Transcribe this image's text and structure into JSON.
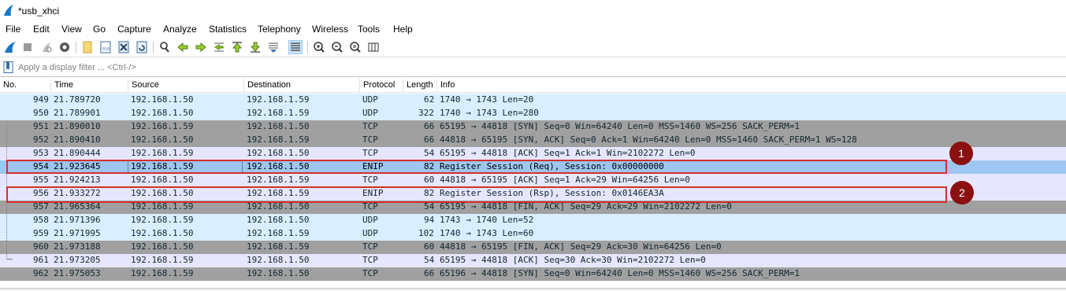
{
  "window": {
    "title": "*usb_xhci"
  },
  "menu": [
    "File",
    "Edit",
    "View",
    "Go",
    "Capture",
    "Analyze",
    "Statistics",
    "Telephony",
    "Wireless",
    "Tools",
    "Help"
  ],
  "filter": {
    "placeholder": "Apply a display filter ... <Ctrl-/>"
  },
  "columns": [
    "No.",
    "Time",
    "Source",
    "Destination",
    "Protocol",
    "Length",
    "Info"
  ],
  "colors": {
    "udp": "#daeeff",
    "tcp_gray": "#a0a0a0",
    "tcp": "#e7e6ff",
    "selected": "#9ec6f0",
    "annotation": "#d32f2f",
    "badge": "#8b1010"
  },
  "packets": [
    {
      "no": "949",
      "time": "21.789720",
      "src": "192.168.1.50",
      "dst": "192.168.1.59",
      "proto": "UDP",
      "len": "62",
      "info": "1740 → 1743 Len=20"
    },
    {
      "no": "950",
      "time": "21.789901",
      "src": "192.168.1.50",
      "dst": "192.168.1.59",
      "proto": "UDP",
      "len": "322",
      "info": "1740 → 1743 Len=280"
    },
    {
      "no": "951",
      "time": "21.890010",
      "src": "192.168.1.59",
      "dst": "192.168.1.50",
      "proto": "TCP",
      "len": "66",
      "info": "65195 → 44818 [SYN] Seq=0 Win=64240 Len=0 MSS=1460 WS=256 SACK_PERM=1"
    },
    {
      "no": "952",
      "time": "21.890410",
      "src": "192.168.1.50",
      "dst": "192.168.1.59",
      "proto": "TCP",
      "len": "66",
      "info": "44818 → 65195 [SYN, ACK] Seq=0 Ack=1 Win=64240 Len=0 MSS=1460 SACK_PERM=1 WS=128"
    },
    {
      "no": "953",
      "time": "21.890444",
      "src": "192.168.1.59",
      "dst": "192.168.1.50",
      "proto": "TCP",
      "len": "54",
      "info": "65195 → 44818 [ACK] Seq=1 Ack=1 Win=2102272 Len=0"
    },
    {
      "no": "954",
      "time": "21.923645",
      "src": "192.168.1.59",
      "dst": "192.168.1.50",
      "proto": "ENIP",
      "len": "82",
      "info": "Register Session (Req), Session: 0x00000000"
    },
    {
      "no": "955",
      "time": "21.924213",
      "src": "192.168.1.50",
      "dst": "192.168.1.59",
      "proto": "TCP",
      "len": "60",
      "info": "44818 → 65195 [ACK] Seq=1 Ack=29 Win=64256 Len=0"
    },
    {
      "no": "956",
      "time": "21.933272",
      "src": "192.168.1.50",
      "dst": "192.168.1.59",
      "proto": "ENIP",
      "len": "82",
      "info": "Register Session (Rsp), Session: 0x0146EA3A"
    },
    {
      "no": "957",
      "time": "21.965364",
      "src": "192.168.1.59",
      "dst": "192.168.1.50",
      "proto": "TCP",
      "len": "54",
      "info": "65195 → 44818 [FIN, ACK] Seq=29 Ack=29 Win=2102272 Len=0"
    },
    {
      "no": "958",
      "time": "21.971396",
      "src": "192.168.1.59",
      "dst": "192.168.1.50",
      "proto": "UDP",
      "len": "94",
      "info": "1743 → 1740 Len=52"
    },
    {
      "no": "959",
      "time": "21.971995",
      "src": "192.168.1.50",
      "dst": "192.168.1.59",
      "proto": "UDP",
      "len": "102",
      "info": "1740 → 1743 Len=60"
    },
    {
      "no": "960",
      "time": "21.973188",
      "src": "192.168.1.50",
      "dst": "192.168.1.59",
      "proto": "TCP",
      "len": "60",
      "info": "44818 → 65195 [FIN, ACK] Seq=29 Ack=30 Win=64256 Len=0"
    },
    {
      "no": "961",
      "time": "21.973205",
      "src": "192.168.1.59",
      "dst": "192.168.1.50",
      "proto": "TCP",
      "len": "54",
      "info": "65195 → 44818 [ACK] Seq=30 Ack=30 Win=2102272 Len=0"
    },
    {
      "no": "962",
      "time": "21.975053",
      "src": "192.168.1.59",
      "dst": "192.168.1.50",
      "proto": "TCP",
      "len": "66",
      "info": "65196 → 44818 [SYN] Seq=0 Win=64240 Len=0 MSS=1460 WS=256 SACK_PERM=1"
    }
  ],
  "annotations": [
    "1",
    "2"
  ]
}
